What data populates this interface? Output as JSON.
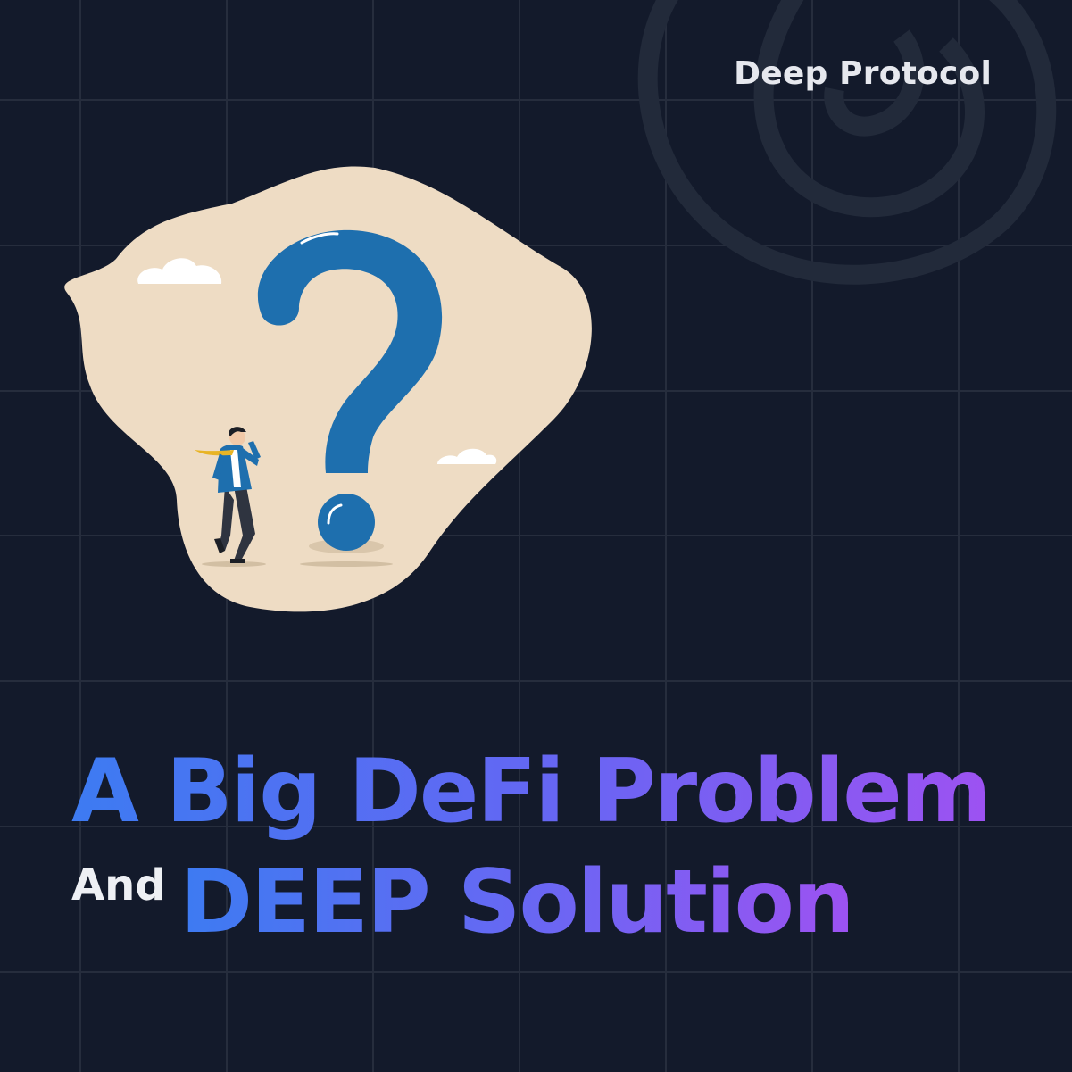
{
  "brand": {
    "name": "Deep Protocol"
  },
  "headline": {
    "line1": "A Big DeFi Problem",
    "connector": "And",
    "line2": "DEEP Solution"
  },
  "colors": {
    "background": "#131a2b",
    "grid": "#262d3d",
    "gradient_start": "#3d7bf2",
    "gradient_end": "#9d52f2",
    "blob": "#eedcc4",
    "question_mark": "#1e6fae"
  },
  "icons": [
    "spiral-logo-icon",
    "question-mark-icon",
    "cloud-icon",
    "businessman-icon"
  ]
}
